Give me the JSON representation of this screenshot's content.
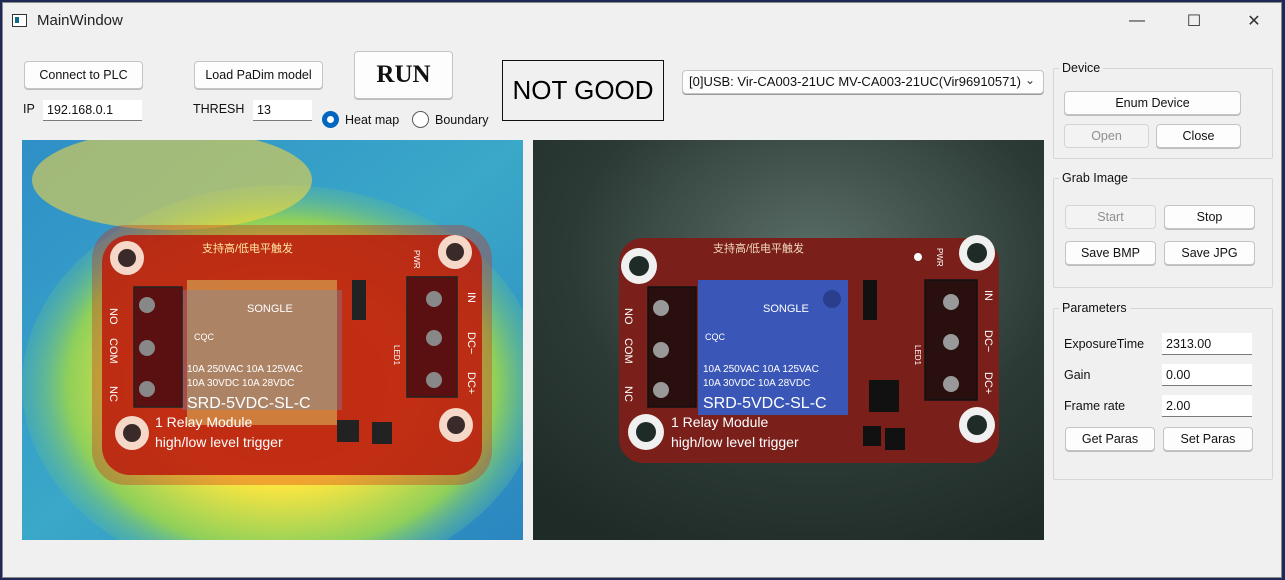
{
  "window": {
    "title": "MainWindow",
    "minimize": "—",
    "maximize": "☐",
    "close": "✕"
  },
  "toolbar": {
    "connect_label": "Connect to PLC",
    "load_model_label": "Load PaDim model",
    "run_label": "RUN",
    "result_text": "NOT GOOD",
    "ip_label": "IP",
    "ip_value": "192.168.0.1",
    "thresh_label": "THRESH",
    "thresh_value": "13",
    "mode_heatmap_label": "Heat map",
    "mode_boundary_label": "Boundary",
    "mode_selected": "Heat map",
    "camera_selected": "[0]USB: Vir-CA003-21UC MV-CA003-21UC(Vir96910571)"
  },
  "device": {
    "title": "Device",
    "enum_label": "Enum Device",
    "open_label": "Open",
    "close_label": "Close"
  },
  "grab": {
    "title": "Grab Image",
    "start_label": "Start",
    "stop_label": "Stop",
    "save_bmp_label": "Save BMP",
    "save_jpg_label": "Save JPG"
  },
  "params": {
    "title": "Parameters",
    "exposure_label": "ExposureTime",
    "exposure_value": "2313.00",
    "gain_label": "Gain",
    "gain_value": "0.00",
    "framerate_label": "Frame rate",
    "framerate_value": "2.00",
    "get_label": "Get Paras",
    "set_label": "Set Paras"
  },
  "board": {
    "header_text": "支持高/低电平触发",
    "brand": "SONGLE",
    "rating1": "10A 250VAC  10A 125VAC",
    "rating2": "10A  30VDC  10A 28VDC",
    "model": "SRD-5VDC-SL-C",
    "caption1": "1 Relay  Module",
    "caption2": "high/low level trigger",
    "pin_no": "NO",
    "pin_com": "COM",
    "pin_nc": "NC",
    "pin_in": "IN",
    "pin_dcm": "DC−",
    "pin_dcp": "DC+",
    "pwr": "PWR",
    "led": "LED1",
    "cert": "CQC"
  },
  "colors": {
    "accent": "#0067c0",
    "board_red": "#7a1f1a",
    "relay_blue": "#3a57b8",
    "mat_green": "#2a3a33"
  }
}
